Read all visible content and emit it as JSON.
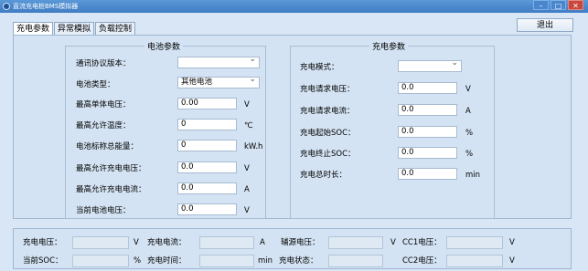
{
  "window": {
    "title": "直流充电桩BMS模拟器",
    "buttons": {
      "minimize": "–",
      "maximize": "□",
      "close": "✕"
    }
  },
  "tabs": [
    {
      "label": "充电参数",
      "active": true
    },
    {
      "label": "异常模拟",
      "active": false
    },
    {
      "label": "负载控制",
      "active": false
    }
  ],
  "exit_label": "退出",
  "battery": {
    "title": "电池参数",
    "fields": [
      {
        "label": "通讯协议版本：",
        "value": "",
        "unit": "",
        "type": "select"
      },
      {
        "label": "电池类型：",
        "value": "其他电池",
        "unit": "",
        "type": "select"
      },
      {
        "label": "最高单体电压：",
        "value": "0.00",
        "unit": "V",
        "type": "text"
      },
      {
        "label": "最高允许温度：",
        "value": "0",
        "unit": "℃",
        "type": "text"
      },
      {
        "label": "电池标称总能量：",
        "value": "0",
        "unit": "kW.h",
        "type": "text"
      },
      {
        "label": "最高允许充电电压：",
        "value": "0.0",
        "unit": "V",
        "type": "text"
      },
      {
        "label": "最高允许充电电流：",
        "value": "0.0",
        "unit": "A",
        "type": "text"
      },
      {
        "label": "当前电池电压：",
        "value": "0.0",
        "unit": "V",
        "type": "text"
      }
    ]
  },
  "charge": {
    "title": "充电参数",
    "fields": [
      {
        "label": "充电模式：",
        "value": "",
        "unit": "",
        "type": "select"
      },
      {
        "label": "充电请求电压：",
        "value": "0.0",
        "unit": "V",
        "type": "text"
      },
      {
        "label": "充电请求电流：",
        "value": "0.0",
        "unit": "A",
        "type": "text"
      },
      {
        "label": "充电起始SOC：",
        "value": "0.0",
        "unit": "%",
        "type": "text"
      },
      {
        "label": "充电终止SOC：",
        "value": "0.0",
        "unit": "%",
        "type": "text"
      },
      {
        "label": "充电总时长：",
        "value": "0.0",
        "unit": "min",
        "type": "text"
      }
    ]
  },
  "status": {
    "row1": [
      {
        "label": "充电电压：",
        "value": "",
        "unit": "V"
      },
      {
        "label": "充电电流：",
        "value": "",
        "unit": "A"
      },
      {
        "label": "辅源电压：",
        "value": "",
        "unit": "V"
      },
      {
        "label": "CC1电压：",
        "value": "",
        "unit": "V"
      }
    ],
    "row2": [
      {
        "label": "当前SOC：",
        "value": "",
        "unit": "%"
      },
      {
        "label": "充电时间：",
        "value": "",
        "unit": "min"
      },
      {
        "label": "充电状态：",
        "value": "",
        "unit": ""
      },
      {
        "label": "CC2电压：",
        "value": "",
        "unit": "V"
      }
    ]
  }
}
